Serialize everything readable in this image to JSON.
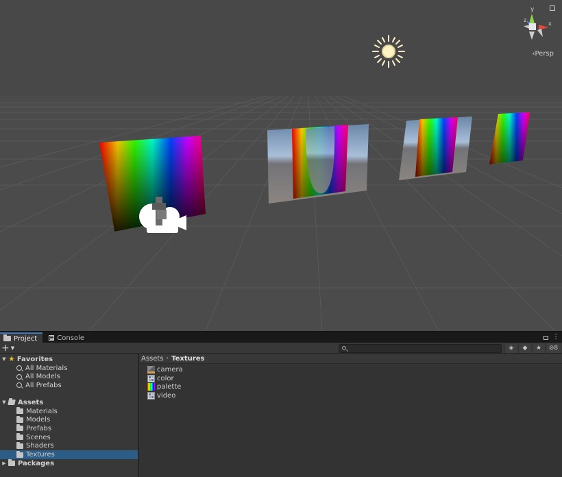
{
  "scene": {
    "persp_label": "‹Persp",
    "gizmo": {
      "y_label": "y",
      "x_label": "x",
      "z_label": "z"
    }
  },
  "panel": {
    "tabs": [
      {
        "label": "Project",
        "icon": "folder-icon",
        "active": true
      },
      {
        "label": "Console",
        "icon": "console-icon",
        "active": false
      }
    ],
    "header_icons": [
      "lock-icon",
      "kebab-menu-icon"
    ],
    "toolbar": {
      "add_label": "+",
      "search_placeholder": "",
      "hidden_count": "8",
      "tool_icons": [
        "search-by-type-icon",
        "search-by-label-icon",
        "favorite-star-icon",
        "hidden-packages-icon"
      ]
    },
    "tree": {
      "favorites": {
        "label": "Favorites",
        "items": [
          "All Materials",
          "All Models",
          "All Prefabs"
        ]
      },
      "assets": {
        "label": "Assets",
        "items": [
          "Materials",
          "Models",
          "Prefabs",
          "Scenes",
          "Shaders",
          "Textures"
        ],
        "selected": "Textures"
      },
      "packages": {
        "label": "Packages"
      }
    },
    "breadcrumb": {
      "root": "Assets",
      "current": "Textures"
    },
    "assets_list": [
      {
        "name": "camera",
        "icon": "render-texture-icon"
      },
      {
        "name": "color",
        "icon": "texture-icon"
      },
      {
        "name": "palette",
        "icon": "palette-texture-icon"
      },
      {
        "name": "video",
        "icon": "texture-icon"
      }
    ]
  }
}
